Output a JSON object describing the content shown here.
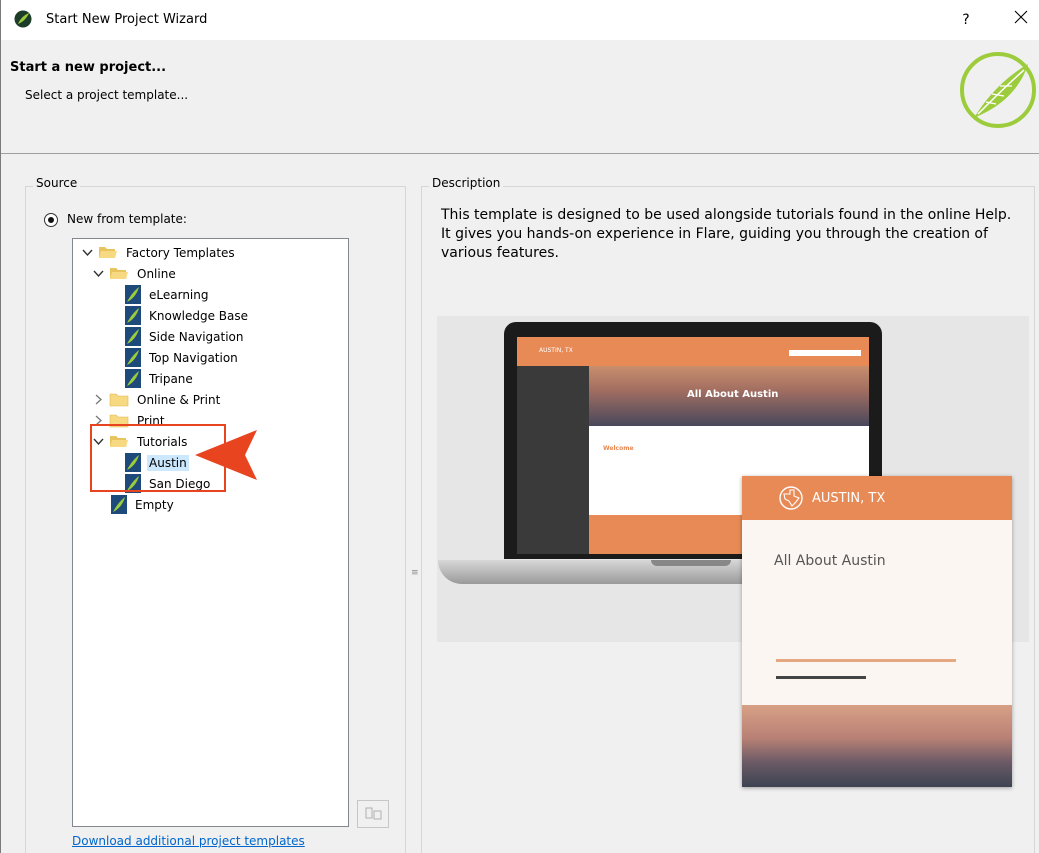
{
  "window": {
    "title": "Start New Project Wizard",
    "help_label": "?",
    "close_label": "✕"
  },
  "header": {
    "title": "Start a new project...",
    "subtitle": "Select a project template..."
  },
  "source": {
    "group_label": "Source",
    "radio_label": "New from template:",
    "download_link": "Download additional project templates"
  },
  "tree": {
    "items": [
      {
        "label": "Factory Templates"
      },
      {
        "label": "Online"
      },
      {
        "label": "eLearning"
      },
      {
        "label": "Knowledge Base"
      },
      {
        "label": "Side Navigation"
      },
      {
        "label": "Top Navigation"
      },
      {
        "label": "Tripane"
      },
      {
        "label": "Online & Print"
      },
      {
        "label": "Print"
      },
      {
        "label": "Tutorials"
      },
      {
        "label": "Austin"
      },
      {
        "label": "San Diego"
      },
      {
        "label": "Empty"
      }
    ]
  },
  "description": {
    "group_label": "Description",
    "text": "This template is designed to be used alongside tutorials found in the online Help. It gives you hands-on experience in Flare, guiding you through the creation of various features."
  },
  "preview": {
    "laptop_brand": "AUSTIN, TX",
    "laptop_hero": "All About Austin",
    "laptop_welcome": "Welcome",
    "doc_brand": "AUSTIN, TX",
    "doc_title": "All About Austin"
  },
  "colors": {
    "accent_orange": "#e88a56",
    "annotation_red": "#e8441f",
    "selection": "#cce8ff",
    "link": "#0066cc"
  }
}
